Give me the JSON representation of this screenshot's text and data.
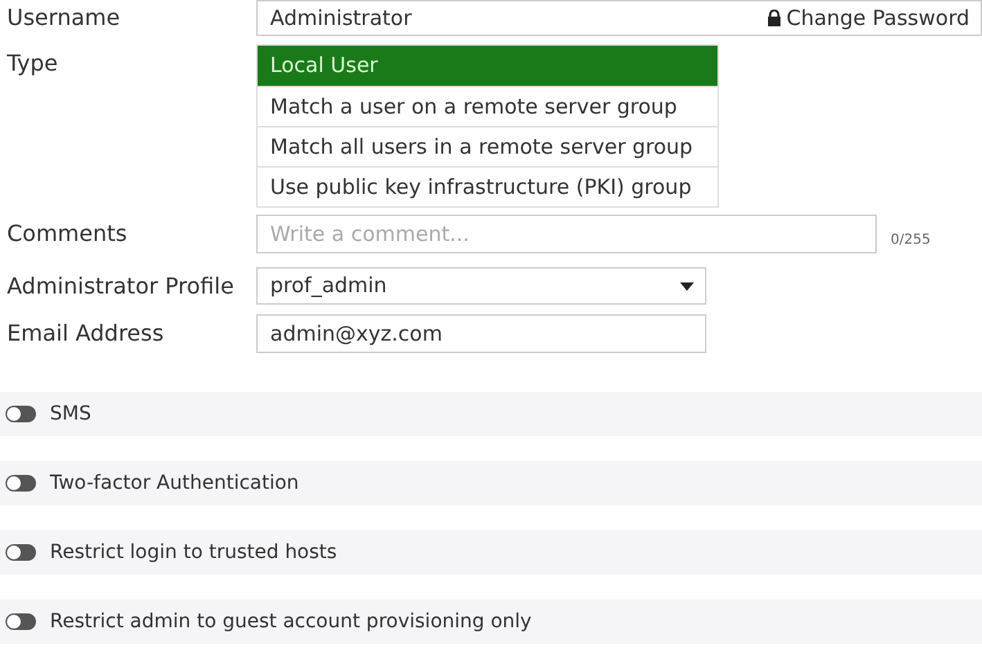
{
  "username": {
    "label": "Username",
    "value": "Administrator",
    "button": "Change Password"
  },
  "type": {
    "label": "Type",
    "options": [
      {
        "label": "Local User",
        "selected": true
      },
      {
        "label": "Match a user on a remote server group",
        "selected": false
      },
      {
        "label": "Match all users in a remote server group",
        "selected": false
      },
      {
        "label": "Use public key infrastructure (PKI) group",
        "selected": false
      }
    ]
  },
  "comments": {
    "label": "Comments",
    "placeholder": "Write a comment...",
    "counter": "0/255"
  },
  "profile": {
    "label": "Administrator Profile",
    "value": "prof_admin"
  },
  "email": {
    "label": "Email Address",
    "value": "admin@xyz.com"
  },
  "toggles": [
    {
      "label": "SMS",
      "on": false
    },
    {
      "label": "Two-factor Authentication",
      "on": false
    },
    {
      "label": "Restrict login to trusted hosts",
      "on": false
    },
    {
      "label": "Restrict admin to guest account provisioning only",
      "on": false
    }
  ]
}
